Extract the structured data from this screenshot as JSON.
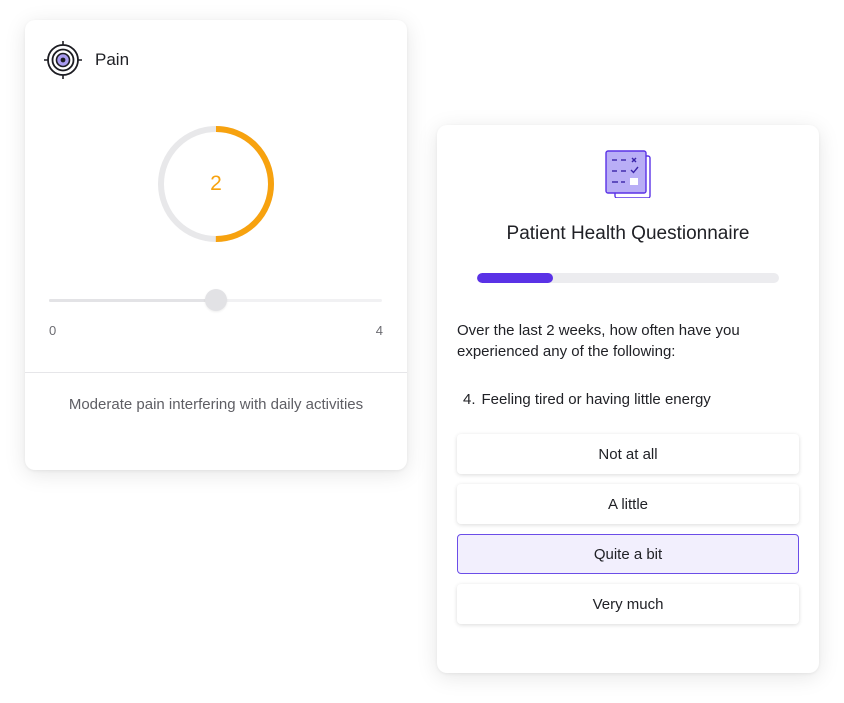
{
  "pain_card": {
    "title": "Pain",
    "icon": "target-icon",
    "gauge": {
      "value": "2",
      "fraction": 0.5,
      "color": "#f7a20f",
      "track_color": "#e8e8ea"
    },
    "slider": {
      "min": "0",
      "max": "4",
      "value": 2
    },
    "description": "Moderate pain interfering with daily activities"
  },
  "questionnaire": {
    "icon": "clipboard-form-icon",
    "title": "Patient Health Questionnaire",
    "progress": 0.25,
    "accent_color": "#5a32e6",
    "prompt": "Over the last 2 weeks, how often have you experienced any of the following:",
    "question_number": "4.",
    "question": "Feeling tired or having little energy",
    "options": [
      {
        "label": "Not at all",
        "selected": false
      },
      {
        "label": "A little",
        "selected": false
      },
      {
        "label": "Quite a bit",
        "selected": true
      },
      {
        "label": "Very much",
        "selected": false
      }
    ]
  }
}
